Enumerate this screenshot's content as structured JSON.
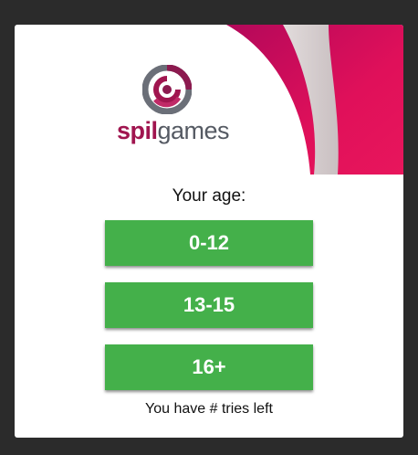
{
  "brand": {
    "name_part1": "spil",
    "name_part2": "games"
  },
  "age_gate": {
    "prompt": "Your age:",
    "options": [
      "0-12",
      "13-15",
      "16+"
    ],
    "tries_text": "You have # tries left"
  },
  "colors": {
    "button_green": "#44b04a",
    "brand_magenta": "#a0154f",
    "decor_pink": "#e0105a"
  }
}
